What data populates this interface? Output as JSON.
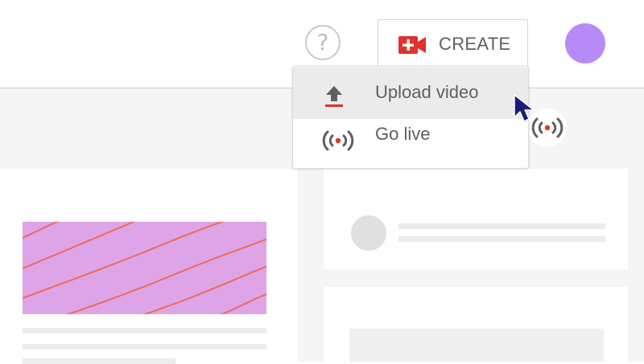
{
  "header": {
    "help_symbol": "?",
    "create_label": "CREATE",
    "create_icon": "video-camera-plus-icon",
    "colors": {
      "create_icon": "#e1322d",
      "avatar": "#b78bf7"
    }
  },
  "menu": {
    "items": [
      {
        "label": "Upload video",
        "icon": "upload-icon",
        "state": "hovered"
      },
      {
        "label": "Go live",
        "icon": "live-broadcast-icon"
      }
    ]
  },
  "page": {
    "thumbnail_color": "#dda4e8",
    "thumbnail_line_color": "#f06a55"
  }
}
